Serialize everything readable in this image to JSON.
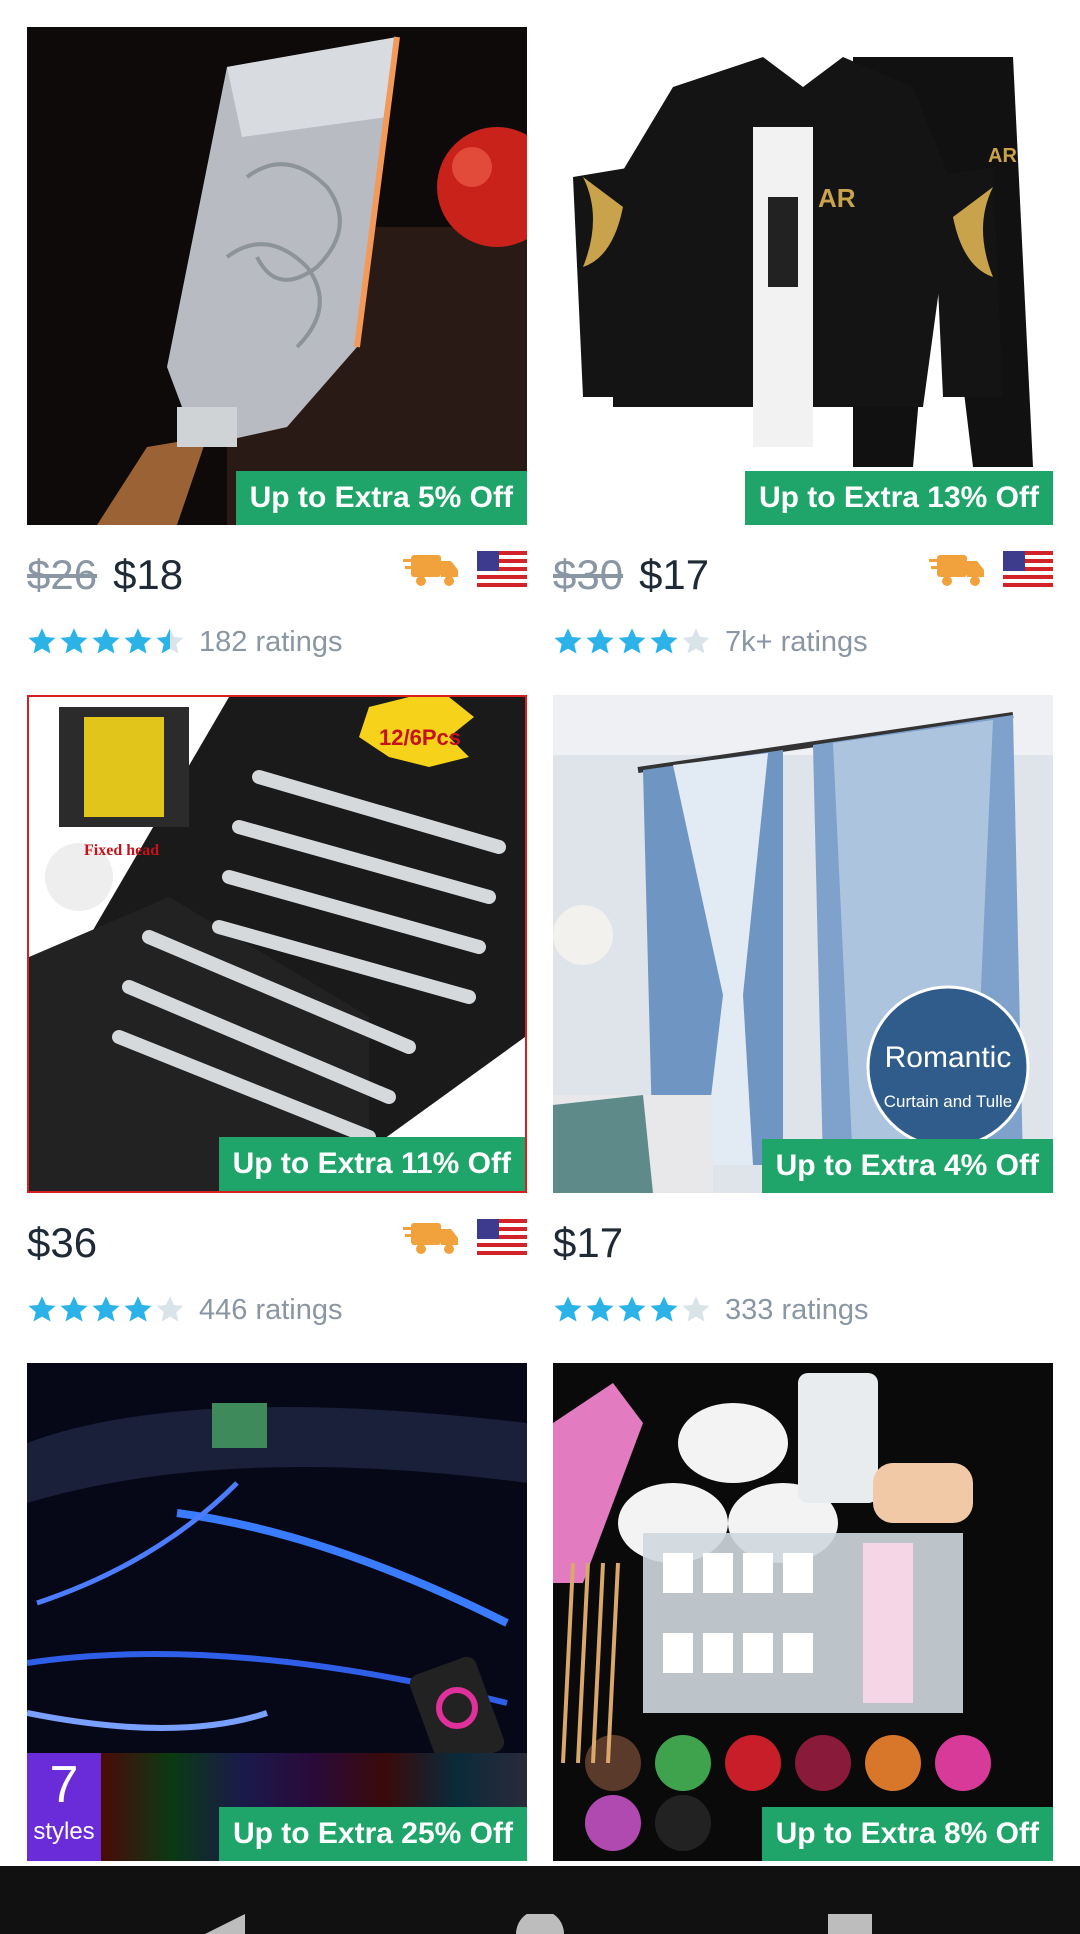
{
  "products": [
    {
      "discount": "Up to Extra 5% Off",
      "old_price": "$26",
      "price": "$18",
      "ratings": "182 ratings",
      "rating": 4.5,
      "shipping": true
    },
    {
      "discount": "Up to Extra 13% Off",
      "old_price": "$30",
      "price": "$17",
      "ratings": "7k+ ratings",
      "rating": 4,
      "shipping": true
    },
    {
      "discount": "Up to Extra 11% Off",
      "old_price": "",
      "price": "$36",
      "ratings": "446 ratings",
      "rating": 4,
      "shipping": true,
      "image_badge": "12/6Pcs",
      "image_caption": "Fixed head"
    },
    {
      "discount": "Up to Extra 4% Off",
      "old_price": "",
      "price": "$17",
      "ratings": "333 ratings",
      "rating": 4,
      "shipping": false,
      "image_title": "Romantic",
      "image_subtitle": "Curtain and Tulle"
    },
    {
      "discount": "Up to Extra 25% Off",
      "styles_count": "7",
      "styles_label": "styles"
    },
    {
      "discount": "Up to Extra 8% Off"
    }
  ],
  "colors": {
    "badge": "#1fa46a",
    "star": "#2bb3e8",
    "star_empty": "#d9e3ea",
    "truck": "#f2a23c",
    "text": "#1f2a36",
    "muted": "#8a96a3"
  },
  "icons": {
    "shipping": "truck-icon",
    "origin": "us-flag-icon"
  }
}
